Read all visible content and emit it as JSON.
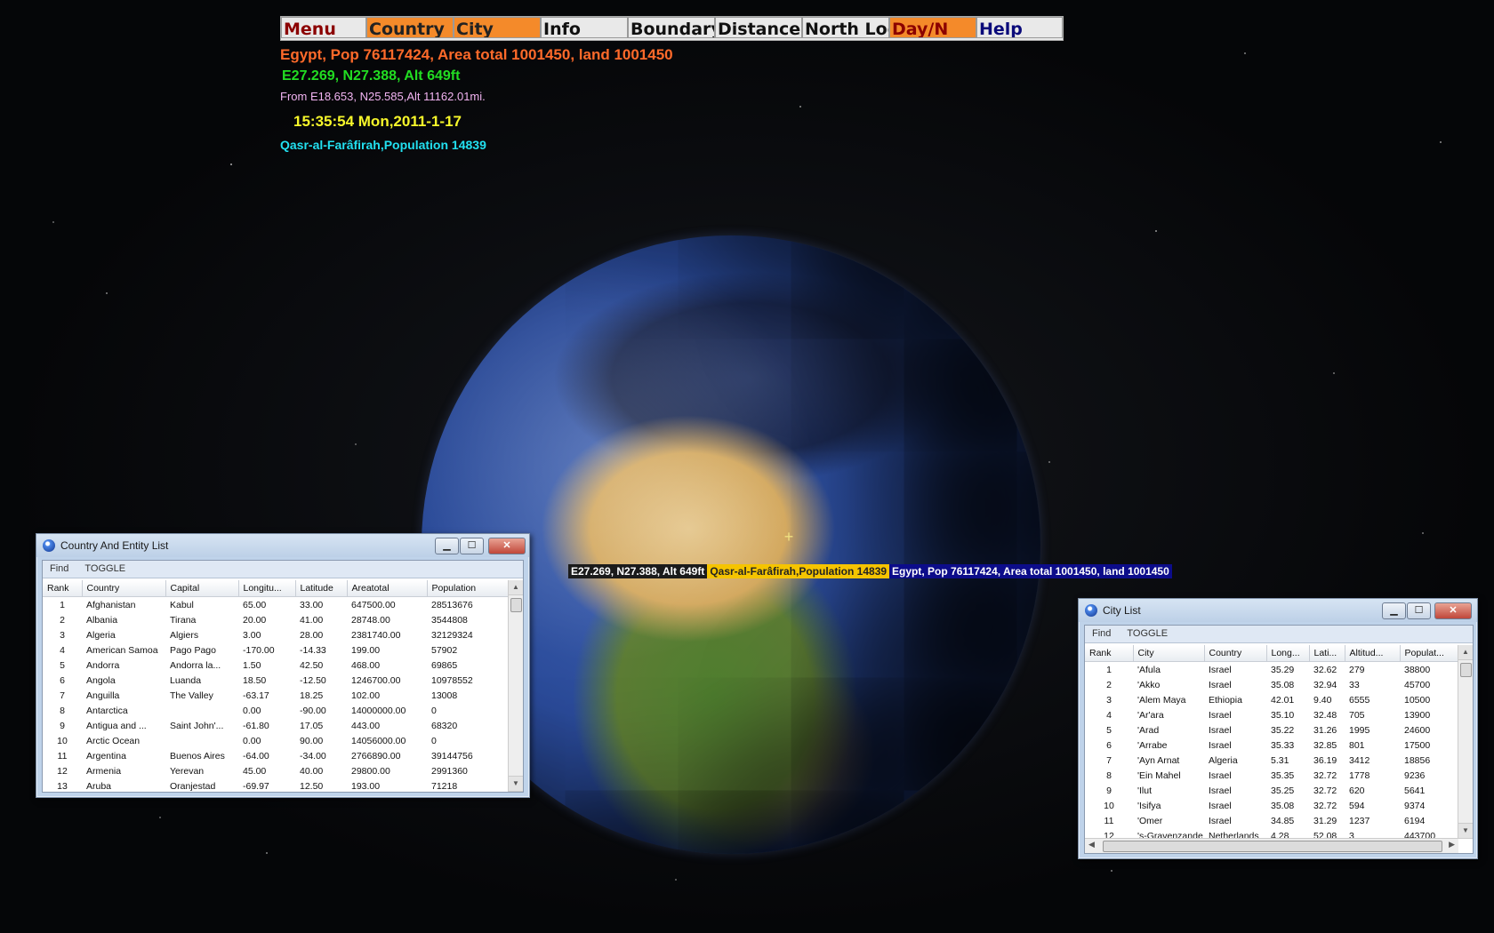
{
  "menubar": {
    "items": [
      {
        "label": "Menu",
        "color": "#8b0000",
        "style": "light"
      },
      {
        "label": "Country",
        "color": "#222",
        "style": "orange"
      },
      {
        "label": "City",
        "color": "#222",
        "style": "orange"
      },
      {
        "label": "Info",
        "color": "#111",
        "style": "light"
      },
      {
        "label": "Boundary",
        "color": "#111",
        "style": "light"
      },
      {
        "label": "Distance",
        "color": "#111",
        "style": "light"
      },
      {
        "label": "North Lock",
        "color": "#111",
        "style": "light"
      },
      {
        "label": "Day/N",
        "color": "#8b0000",
        "style": "orange"
      },
      {
        "label": "Help",
        "color": "#0a0a7a",
        "style": "light"
      }
    ]
  },
  "hud": {
    "country_line": "Egypt, Pop  76117424, Area total 1001450, land 1001450",
    "coords_line": "E27.269, N27.388, Alt 649ft",
    "from_line": "From E18.653, N25.585,Alt 11162.01mi.",
    "time_line": "15:35:54 Mon,2011-1-17",
    "city_line": "Qasr-al-Farâfirah,Population  14839",
    "colors": {
      "country": "#ff6a2a",
      "coords": "#22dd22",
      "from": "#f2b4f2",
      "time": "#f7f72a",
      "city": "#22e0f0"
    }
  },
  "globe_label": {
    "coords": "E27.269, N27.388, Alt 649ft",
    "city": "Qasr-al-Farâfirah,Population  14839",
    "country": "Egypt, Pop  76117424, Area total 1001450, land 1001450"
  },
  "country_window": {
    "title": "Country And Entity List",
    "toolbar": [
      "Find",
      "TOGGLE"
    ],
    "columns": [
      "Rank",
      "Country",
      "Capital",
      "Longitu...",
      "Latitude",
      "Areatotal",
      "Population"
    ],
    "rows": [
      [
        "1",
        "Afghanistan",
        "Kabul",
        "65.00",
        "33.00",
        "647500.00",
        "28513676"
      ],
      [
        "2",
        "Albania",
        "Tirana",
        "20.00",
        "41.00",
        "28748.00",
        "3544808"
      ],
      [
        "3",
        "Algeria",
        "Algiers",
        "3.00",
        "28.00",
        "2381740.00",
        "32129324"
      ],
      [
        "4",
        "American Samoa",
        "Pago Pago",
        "-170.00",
        "-14.33",
        "199.00",
        "57902"
      ],
      [
        "5",
        "Andorra",
        "Andorra la...",
        "1.50",
        "42.50",
        "468.00",
        "69865"
      ],
      [
        "6",
        "Angola",
        "Luanda",
        "18.50",
        "-12.50",
        "1246700.00",
        "10978552"
      ],
      [
        "7",
        "Anguilla",
        "The Valley",
        "-63.17",
        "18.25",
        "102.00",
        "13008"
      ],
      [
        "8",
        "Antarctica",
        "",
        "0.00",
        "-90.00",
        "14000000.00",
        "0"
      ],
      [
        "9",
        "Antigua and ...",
        "Saint John'...",
        "-61.80",
        "17.05",
        "443.00",
        "68320"
      ],
      [
        "10",
        "Arctic Ocean",
        "",
        "0.00",
        "90.00",
        "14056000.00",
        "0"
      ],
      [
        "11",
        "Argentina",
        "Buenos Aires",
        "-64.00",
        "-34.00",
        "2766890.00",
        "39144756"
      ],
      [
        "12",
        "Armenia",
        "Yerevan",
        "45.00",
        "40.00",
        "29800.00",
        "2991360"
      ],
      [
        "13",
        "Aruba",
        "Oranjestad",
        "-69.97",
        "12.50",
        "193.00",
        "71218"
      ]
    ]
  },
  "city_window": {
    "title": "City List",
    "toolbar": [
      "Find",
      "TOGGLE"
    ],
    "columns": [
      "Rank",
      "City",
      "Country",
      "Long...",
      "Lati...",
      "Altitud...",
      "Populat..."
    ],
    "rows": [
      [
        "1",
        "'Afula",
        "Israel",
        "35.29",
        "32.62",
        "279",
        "38800"
      ],
      [
        "2",
        "'Akko",
        "Israel",
        "35.08",
        "32.94",
        "33",
        "45700"
      ],
      [
        "3",
        "'Alem Maya",
        "Ethiopia",
        "42.01",
        "9.40",
        "6555",
        "10500"
      ],
      [
        "4",
        "'Ar'ara",
        "Israel",
        "35.10",
        "32.48",
        "705",
        "13900"
      ],
      [
        "5",
        "'Arad",
        "Israel",
        "35.22",
        "31.26",
        "1995",
        "24600"
      ],
      [
        "6",
        "'Arrabe",
        "Israel",
        "35.33",
        "32.85",
        "801",
        "17500"
      ],
      [
        "7",
        "'Ayn Arnat",
        "Algeria",
        "5.31",
        "36.19",
        "3412",
        "18856"
      ],
      [
        "8",
        "'Ein Mahel",
        "Israel",
        "35.35",
        "32.72",
        "1778",
        "9236"
      ],
      [
        "9",
        "'Ilut",
        "Israel",
        "35.25",
        "32.72",
        "620",
        "5641"
      ],
      [
        "10",
        "'Isifya",
        "Israel",
        "35.08",
        "32.72",
        "594",
        "9374"
      ],
      [
        "11",
        "'Omer",
        "Israel",
        "34.85",
        "31.29",
        "1237",
        "6194"
      ],
      [
        "12",
        "'s-Gravenzande",
        "Netherlands",
        "4.28",
        "52.08",
        "3",
        "443700"
      ]
    ]
  }
}
